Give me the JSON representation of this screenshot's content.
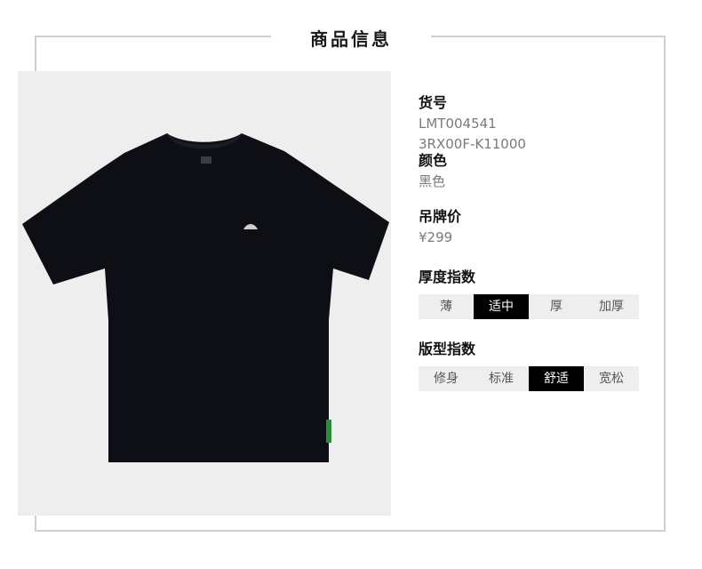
{
  "header": {
    "title": "商品信息"
  },
  "product": {
    "sku_label": "货号",
    "sku_line1": "LMT004541",
    "sku_line2": "3RX00F-K11000",
    "color_label": "颜色",
    "color_value": "黑色",
    "price_label": "吊牌价",
    "price_value": "¥299"
  },
  "thickness": {
    "label": "厚度指数",
    "options": [
      "薄",
      "适中",
      "厚",
      "加厚"
    ],
    "selected": "适中"
  },
  "fit": {
    "label": "版型指数",
    "options": [
      "修身",
      "标准",
      "舒适",
      "宽松"
    ],
    "selected": "舒适"
  },
  "colors": {
    "shirt": "#0d0f14",
    "photo_bg": "#eeeeee",
    "active": "#000000"
  }
}
